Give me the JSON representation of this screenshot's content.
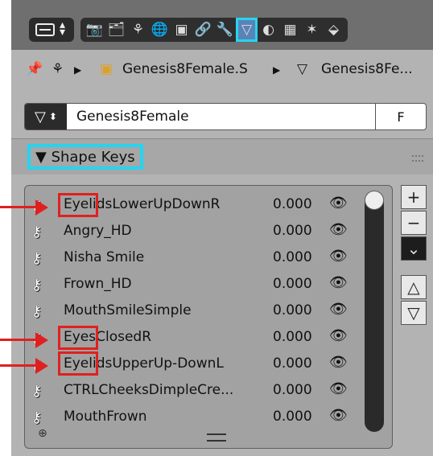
{
  "toolbar": {
    "editor_icon": "properties-editor-icon",
    "tabs": [
      {
        "name": "render",
        "glyph": "📷"
      },
      {
        "name": "render-layers",
        "glyph": "🗂"
      },
      {
        "name": "scene",
        "glyph": "⚘"
      },
      {
        "name": "world",
        "glyph": "🌐"
      },
      {
        "name": "object",
        "glyph": "▣"
      },
      {
        "name": "constraints",
        "glyph": "🔗"
      },
      {
        "name": "modifiers",
        "glyph": "🔧"
      },
      {
        "name": "data",
        "glyph": "▽",
        "active": true
      },
      {
        "name": "material",
        "glyph": "◐"
      },
      {
        "name": "texture",
        "glyph": "▦"
      },
      {
        "name": "particles",
        "glyph": "✶"
      },
      {
        "name": "physics",
        "glyph": "⬙"
      }
    ]
  },
  "breadcrumb": {
    "object": "Genesis8Female.S",
    "mesh": "Genesis8Fe..."
  },
  "mesh": {
    "name": "Genesis8Female",
    "fake_user": "F"
  },
  "shape_keys": {
    "title": "▼ Shape Keys",
    "items": [
      {
        "name": "EyelidsLowerUpDownR",
        "value": "0.000"
      },
      {
        "name": "Angry_HD",
        "value": "0.000"
      },
      {
        "name": "Nisha Smile",
        "value": "0.000"
      },
      {
        "name": "Frown_HD",
        "value": "0.000"
      },
      {
        "name": "MouthSmileSimple",
        "value": "0.000"
      },
      {
        "name": "EyesClosedR",
        "value": "0.000"
      },
      {
        "name": "EyelidsUpperUp-DownL",
        "value": "0.000"
      },
      {
        "name": "CTRLCheeksDimpleCre...",
        "value": "0.000"
      },
      {
        "name": "MouthFrown",
        "value": "0.000"
      }
    ]
  },
  "side_buttons": [
    "+",
    "−",
    "⌄",
    "△",
    "▽"
  ],
  "colors": {
    "highlight_cyan": "#26d4f0",
    "annotation_red": "#e02020",
    "active_tab": "#5a83b8"
  }
}
